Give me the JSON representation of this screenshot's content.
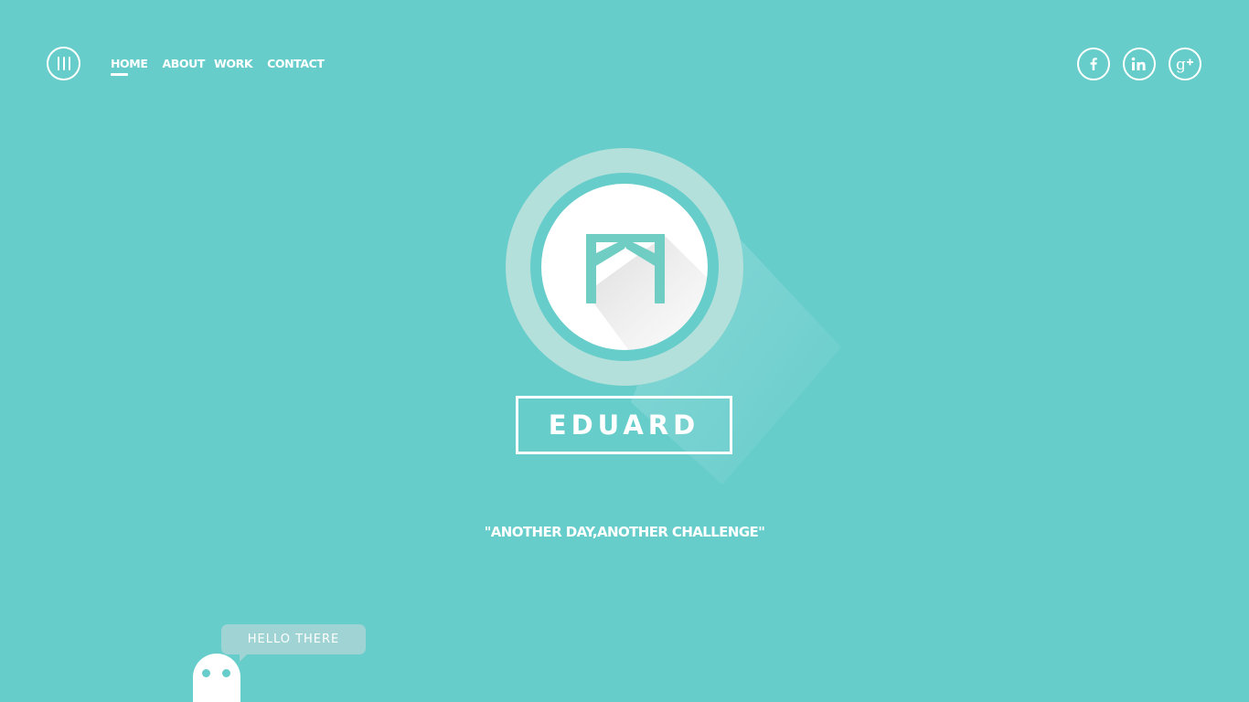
{
  "colors": {
    "background": "#67cdcb",
    "accent": "#ffffff",
    "logo_ring": "#b3e0da",
    "logo_mark": "#6fcdc4",
    "bubble": "#a0d3d3"
  },
  "menu": {
    "icon": "hamburger-vertical-icon"
  },
  "nav": {
    "items": [
      {
        "label": "HOME",
        "active": true
      },
      {
        "label": "ABOUT",
        "active": false
      },
      {
        "label": "WORK",
        "active": false
      },
      {
        "label": "CONTACT",
        "active": false
      }
    ]
  },
  "social": {
    "items": [
      {
        "icon": "facebook-icon",
        "glyph": "f"
      },
      {
        "icon": "linkedin-icon",
        "glyph": "in"
      },
      {
        "icon": "google-plus-icon",
        "glyph": "g+"
      }
    ]
  },
  "hero": {
    "name": "EDUARD",
    "logo_icon": "eduard-monogram-icon",
    "tagline": "\"ANOTHER DAY,ANOTHER CHALLENGE\""
  },
  "mascot": {
    "greeting": "HELLO THERE"
  }
}
